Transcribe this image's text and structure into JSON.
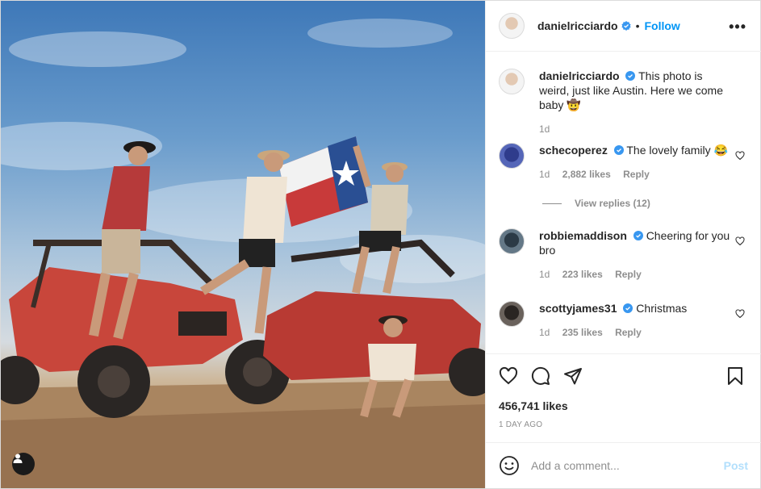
{
  "post": {
    "username": "danielricciardo",
    "follow_label": "Follow",
    "more_label": "•••",
    "caption": "This photo is weird, just like Austin. Here we come baby 🤠",
    "caption_age": "1d",
    "likes": "456,741 likes",
    "date": "1 DAY AGO"
  },
  "comments": [
    {
      "username": "schecoperez",
      "text": "The lovely family 😂",
      "age": "1d",
      "likes": "2,882 likes",
      "reply": "Reply"
    },
    {
      "username": "robbiemaddison",
      "text": "Cheering for you bro",
      "age": "1d",
      "likes": "223 likes",
      "reply": "Reply"
    },
    {
      "username": "scottyjames31",
      "text": "Christmas",
      "age": "1d",
      "likes": "235 likes",
      "reply": "Reply"
    }
  ],
  "view_replies": "View replies (12)",
  "add_comment": {
    "placeholder": "Add a comment...",
    "post_label": "Post"
  },
  "icons": {
    "verified": "verified-badge-icon",
    "like": "heart-icon",
    "comment": "speech-bubble-icon",
    "share": "paper-plane-icon",
    "save": "bookmark-icon",
    "emoji": "smiley-icon",
    "tag": "person-icon"
  },
  "colors": {
    "accent": "#0095f6",
    "verified": "#3897f0",
    "post_disabled": "#b2dffc",
    "secondary_text": "#8e8e8e"
  }
}
